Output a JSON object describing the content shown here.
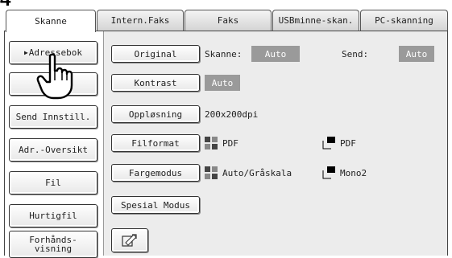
{
  "step_number": "4",
  "tabs": [
    "Skanne",
    "Intern.Faks",
    "Faks",
    "USBminne-skan.",
    "PC-skanning"
  ],
  "left_buttons": {
    "address_book": "Adressebok",
    "send_settings": "Send Innstill.",
    "addr_overview": "Adr.-Oversikt",
    "file": "Fil",
    "quick_file": "Hurtigfil",
    "preview_line1": "Forhånds-",
    "preview_line2": "visning"
  },
  "settings": {
    "original": {
      "label": "Original",
      "scan_label": "Skanne:",
      "scan_value": "Auto",
      "send_label": "Send:",
      "send_value": "Auto"
    },
    "contrast": {
      "label": "Kontrast",
      "value": "Auto"
    },
    "resolution": {
      "label": "Oppløsning",
      "value": "200x200dpi"
    },
    "file_format": {
      "label": "Filformat",
      "value_color": "PDF",
      "value_mono": "PDF"
    },
    "color_mode": {
      "label": "Fargemodus",
      "value_color": "Auto/Gråskala",
      "value_mono": "Mono2"
    },
    "special_modes": {
      "label": "Spesial Modus"
    }
  },
  "icons": {
    "pointer_hand": "hand-pointer-icon",
    "edit": "edit-icon",
    "color_doc": "color-document-icon",
    "mono_doc": "mono-document-icon"
  },
  "colors": {
    "value_badge": "#9a9a9a",
    "panel": "#ececec"
  }
}
